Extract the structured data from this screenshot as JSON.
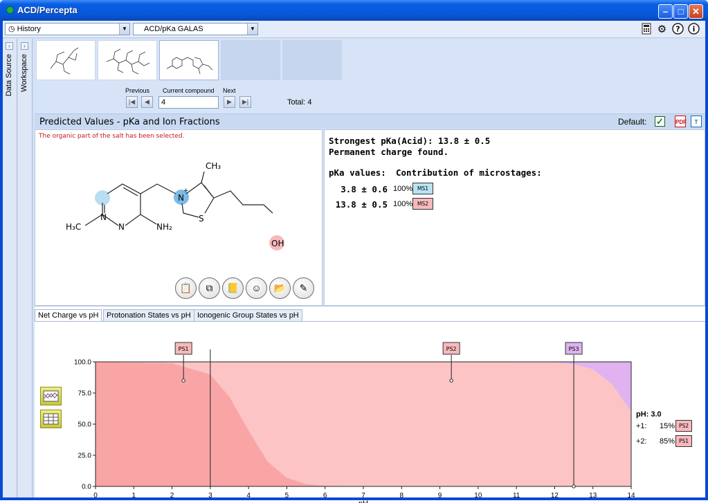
{
  "app": {
    "title": "ACD/Percepta"
  },
  "toolbar": {
    "history_label": "History",
    "module_label": "ACD/pKa GALAS"
  },
  "side_tabs": {
    "data_source": "Data Source",
    "workspace": "Workspace"
  },
  "navigator": {
    "previous_label": "Previous",
    "current_label": "Current compound",
    "next_label": "Next",
    "current_value": "4",
    "total_label": "Total: 4"
  },
  "section": {
    "title": "Predicted Values - pKa and Ion Fractions",
    "default_label": "Default:"
  },
  "structure": {
    "warning": "The organic part of the salt has been selected."
  },
  "results": {
    "strongest": "Strongest pKa(Acid): 13.8 ± 0.5",
    "charge": "Permanent charge found.",
    "pka_header": "pKa values:",
    "micro_header": "Contribution of microstages:",
    "rows": [
      {
        "value": "3.8 ± 0.6",
        "percent": "100%",
        "badge": "MS1",
        "color": "#b8e4f2"
      },
      {
        "value": "13.8 ± 0.5",
        "percent": "100%",
        "badge": "MS2",
        "color": "#f7b9bc"
      }
    ]
  },
  "graph_tabs": [
    "Net Charge vs pH",
    "Protonation States vs pH",
    "Ionogenic Group States vs pH"
  ],
  "chart_data": {
    "type": "area",
    "xlabel": "pH",
    "ylabel": "",
    "xlim": [
      0,
      14
    ],
    "ylim": [
      0,
      100
    ],
    "x_ticks": [
      "0",
      "1",
      "2",
      "3",
      "4",
      "5",
      "6",
      "7",
      "8",
      "9",
      "10",
      "11",
      "12",
      "13",
      "14"
    ],
    "y_ticks": [
      "0.0",
      "25.0",
      "50.0",
      "75.0",
      "100.0"
    ],
    "series": [
      {
        "name": "PS1",
        "color": "#f9a5a5",
        "x": [
          0,
          2,
          3,
          3.5,
          4,
          4.5,
          5,
          5.5,
          6,
          14
        ],
        "values": [
          100,
          99,
          90,
          72,
          45,
          20,
          7,
          2,
          0.5,
          0
        ]
      },
      {
        "name": "PS2",
        "color": "#fcc4c4",
        "x": [
          0,
          2,
          3,
          3.5,
          4,
          4.5,
          5,
          5.5,
          6,
          12,
          12.5,
          13,
          13.5,
          14
        ],
        "values": [
          0,
          1,
          10,
          28,
          55,
          80,
          93,
          98,
          99.5,
          99.5,
          98,
          94,
          82,
          60
        ]
      },
      {
        "name": "PS3",
        "color": "#e0b3f0",
        "x": [
          0,
          12,
          12.5,
          13,
          13.5,
          14
        ],
        "values": [
          0,
          0.5,
          2,
          6,
          18,
          40
        ]
      }
    ],
    "markers": [
      {
        "label": "PS1",
        "x": 2.3,
        "y": 85,
        "color": "#f7b9bc"
      },
      {
        "label": "PS2",
        "x": 9.3,
        "y": 85,
        "color": "#f7b9bc"
      },
      {
        "label": "PS3",
        "x": 12.5,
        "y": 0,
        "color": "#dcb3f0"
      }
    ],
    "cursor_ph": 3.0,
    "grid": false
  },
  "legend": {
    "title": "pH: 3.0",
    "rows": [
      {
        "charge": "+1:",
        "percent": "15%",
        "badge": "PS2"
      },
      {
        "charge": "+2:",
        "percent": "85%",
        "badge": "PS1"
      }
    ]
  },
  "icons": [
    "calculator-icon",
    "gear-icon",
    "help-icon",
    "info-icon",
    "pdf-icon",
    "copy-text-icon"
  ]
}
